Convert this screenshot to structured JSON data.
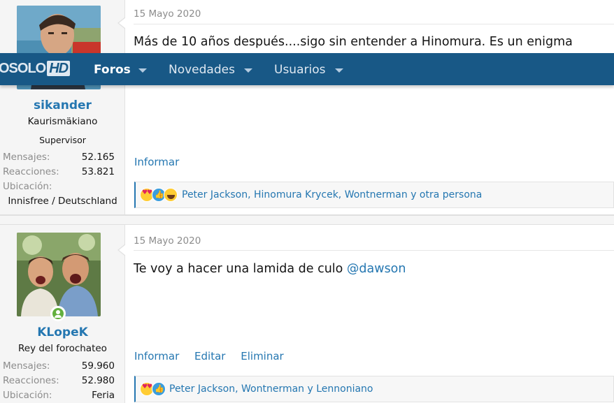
{
  "navbar": {
    "logo_prefix": "OSOLO",
    "logo_suffix": "HD",
    "items": [
      {
        "label": "Foros",
        "active": true
      },
      {
        "label": "Novedades",
        "active": false
      },
      {
        "label": "Usuarios",
        "active": false
      }
    ],
    "background": "#185886"
  },
  "posts": [
    {
      "user": {
        "username": "sikander",
        "title": "Kaurismäkiano",
        "banner": "Supervisor",
        "stats": {
          "messages_label": "Mensajes:",
          "messages_value": "52.165",
          "reactions_label": "Reacciones:",
          "reactions_value": "53.821",
          "location_label": "Ubicación:",
          "location_value": "Innisfree / Deutschland"
        }
      },
      "date": "15 Mayo 2020",
      "content": "Más de 10 años después....sigo sin entender a Hinomura. Es un enigma",
      "actions": [
        "Informar"
      ],
      "reactions": {
        "icons": [
          "love-reaction-icon",
          "like-reaction-icon",
          "haha-reaction-icon"
        ],
        "names": "Peter Jackson, Hinomura Krycek, Wontnerman y otra persona"
      }
    },
    {
      "user": {
        "username": "KLopeK",
        "title": "Rey del forochateo",
        "online": true,
        "stats": {
          "messages_label": "Mensajes:",
          "messages_value": "59.960",
          "reactions_label": "Reacciones:",
          "reactions_value": "52.980",
          "location_label": "Ubicación:",
          "location_value": "Feria"
        }
      },
      "date": "15 Mayo 2020",
      "content_prefix": "Te voy a hacer una lamida de culo ",
      "content_mention": "@dawson",
      "actions": [
        "Informar",
        "Editar",
        "Eliminar"
      ],
      "reactions": {
        "icons": [
          "love-reaction-icon",
          "like-reaction-icon"
        ],
        "names": "Peter Jackson, Wontnerman y Lennoniano"
      }
    }
  ],
  "colors": {
    "link": "#2577b1",
    "muted": "#8c8c8c",
    "online": "#63b03e"
  }
}
